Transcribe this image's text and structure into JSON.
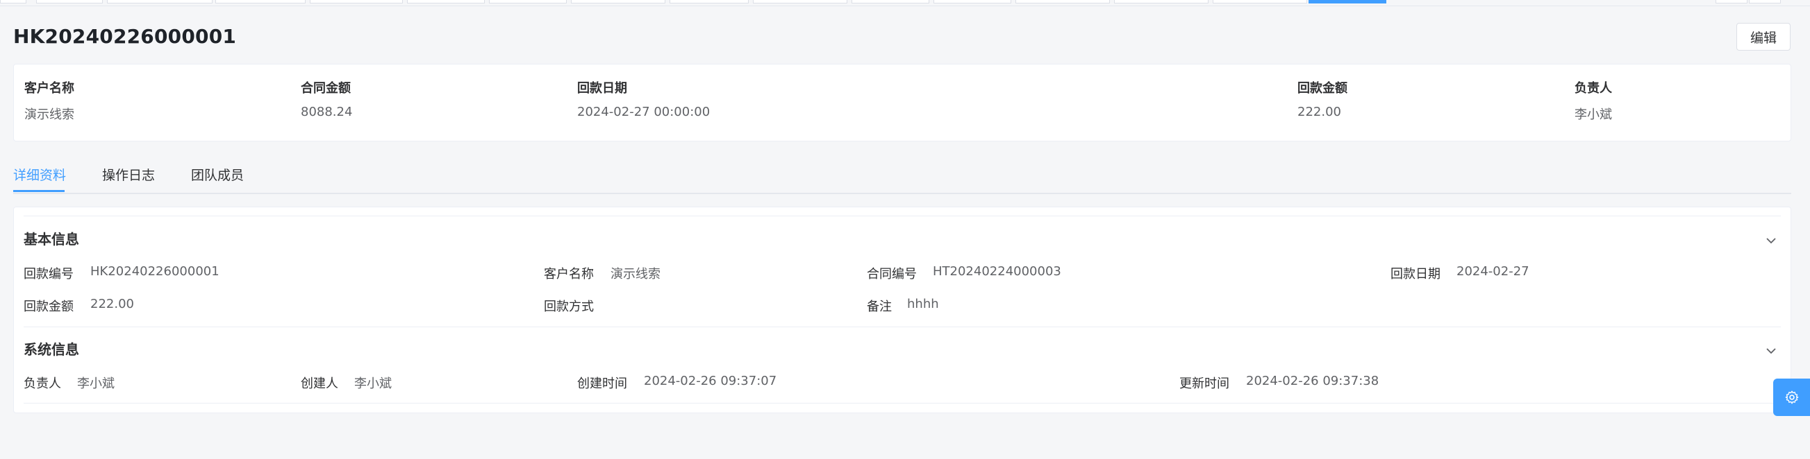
{
  "header": {
    "title": "HK20240226000001",
    "edit_label": "编辑"
  },
  "summary": {
    "fields": [
      {
        "label": "客户名称",
        "value": "演示线索"
      },
      {
        "label": "合同金额",
        "value": "8088.24"
      },
      {
        "label": "回款日期",
        "value": "2024-02-27 00:00:00"
      },
      {
        "label": "回款金额",
        "value": "222.00"
      },
      {
        "label": "负责人",
        "value": "李小斌"
      }
    ]
  },
  "tabs": [
    {
      "label": "详细资料",
      "active": true
    },
    {
      "label": "操作日志",
      "active": false
    },
    {
      "label": "团队成员",
      "active": false
    }
  ],
  "basic": {
    "title": "基本信息",
    "fields": [
      {
        "label": "回款编号",
        "value": "HK20240226000001"
      },
      {
        "label": "客户名称",
        "value": "演示线索"
      },
      {
        "label": "合同编号",
        "value": "HT20240224000003"
      },
      {
        "label": "回款日期",
        "value": "2024-02-27"
      },
      {
        "label": "回款金额",
        "value": "222.00"
      },
      {
        "label": "回款方式",
        "value": ""
      },
      {
        "label": "备注",
        "value": "hhhh"
      }
    ]
  },
  "system": {
    "title": "系统信息",
    "fields": [
      {
        "label": "负责人",
        "value": "李小斌"
      },
      {
        "label": "创建人",
        "value": "李小斌"
      },
      {
        "label": "创建时间",
        "value": "2024-02-26 09:37:07"
      },
      {
        "label": "更新时间",
        "value": "2024-02-26 09:37:38"
      }
    ]
  },
  "icons": {
    "collapse": "chevron-down-icon",
    "settings": "gear-icon"
  },
  "colors": {
    "accent": "#409eff",
    "background": "#f5f6f8"
  }
}
